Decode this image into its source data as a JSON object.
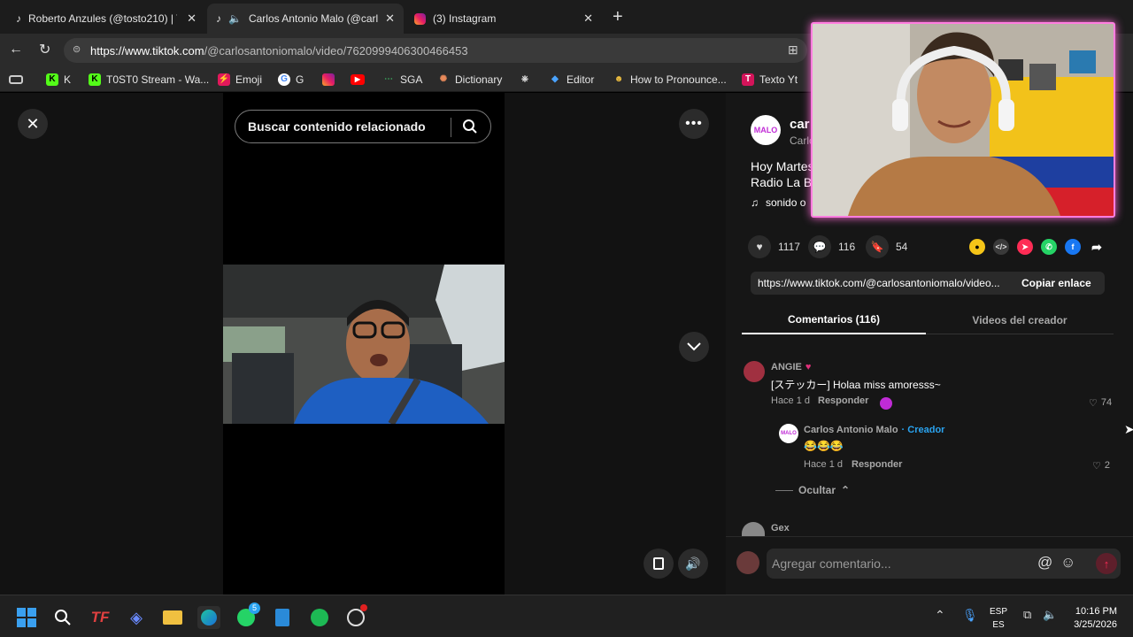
{
  "tabs": [
    {
      "title": "Roberto Anzules (@tosto210) | Tik",
      "icon": "tiktok-icon"
    },
    {
      "title": "Carlos Antonio Malo (@carlos",
      "icon": "tiktok-icon"
    },
    {
      "title": "(3) Instagram",
      "icon": "instagram-icon"
    }
  ],
  "address": {
    "host": "https://www.tiktok.com",
    "path": "/@carlosantoniomalo/video/7620999406300466453"
  },
  "bookmarks": [
    "K",
    "T0ST0 Stream - Wa...",
    "Emoji",
    "G",
    "",
    "",
    "SGA",
    "Dictionary",
    "",
    "Editor",
    "How to Pronounce...",
    "Texto Yt"
  ],
  "player": {
    "search_placeholder": "Buscar contenido relacionado"
  },
  "author": {
    "name_partial": "car",
    "handle_partial": "Carlc",
    "avatar_text": "MALO",
    "desc_line1": "Hoy Martes",
    "desc_line2": "Radio La B",
    "sound": "sonido o"
  },
  "actions": {
    "likes": "1117",
    "comments": "116",
    "saves": "54"
  },
  "share_link": {
    "url": "https://www.tiktok.com/@carlosantoniomalo/video...",
    "copy_label": "Copiar enlace"
  },
  "comment_tabs": {
    "comments": "Comentarios (116)",
    "creator": "Videos del creador"
  },
  "comments": [
    {
      "user": "ANGIE",
      "text": "[ステッカー] Holaa miss amoresss~",
      "time": "Hace 1 d",
      "reply": "Responder",
      "likes": "74"
    },
    {
      "user": "Carlos Antonio Malo",
      "creator_tag": "· Creador",
      "text": "😂😂😂",
      "time": "Hace 1 d",
      "reply": "Responder",
      "likes": "2"
    }
  ],
  "hide_label": "Ocultar",
  "next_user": "Gex",
  "add_comment_placeholder": "Agregar comentario...",
  "tray": {
    "lang1": "ESP",
    "lang2": "ES",
    "time": "10:16 PM",
    "date": "3/25/2026",
    "whatsapp_badge": "5"
  },
  "colors": {
    "accent": "#fe2c55",
    "creator": "#2aa3ef",
    "webcam_border": "#ff7de0"
  }
}
